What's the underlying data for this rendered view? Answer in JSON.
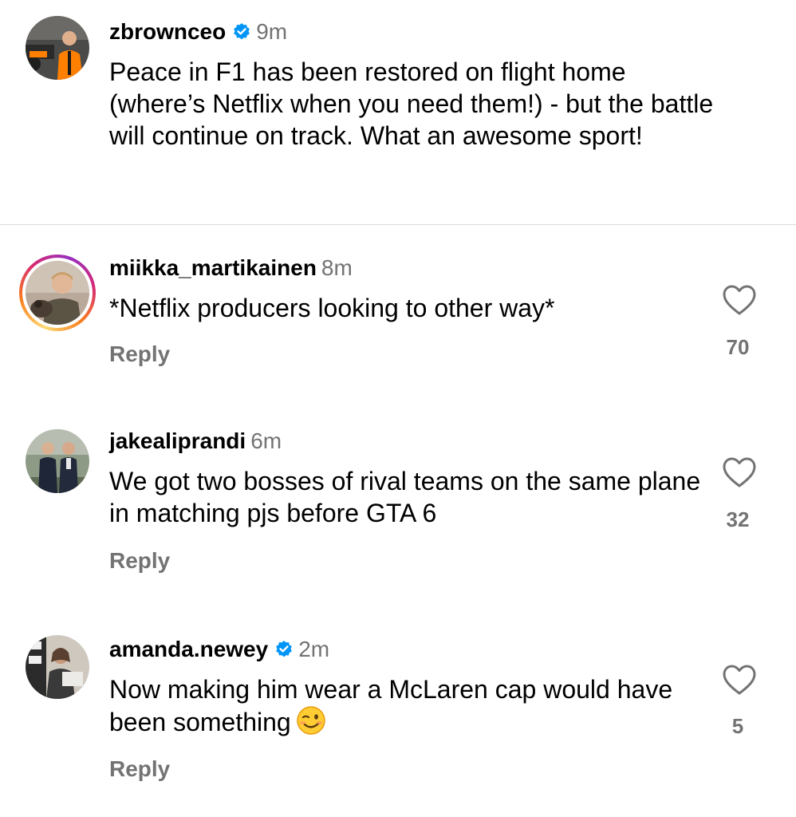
{
  "caption": {
    "username": "zbrownceo",
    "time": "9m",
    "text": "Peace in F1 has been restored on flight home (where’s Netflix when you need them!) - but the battle will continue on track. What an awesome sport!"
  },
  "comments": [
    {
      "username": "miikka_martikainen",
      "time": "8m",
      "text": "*Netflix producers looking to other way*",
      "reply_label": "Reply",
      "likes": "70"
    },
    {
      "username": "jakealiprandi",
      "time": "6m",
      "text": "We got two bosses of rival teams on the same plane in matching pjs before GTA 6",
      "reply_label": "Reply",
      "likes": "32"
    },
    {
      "username": "amanda.newey",
      "time": "2m",
      "text": "Now making him wear a McLaren cap would have been something",
      "emoji": "😉",
      "reply_label": "Reply",
      "likes": "5"
    }
  ],
  "icons": {
    "verified": "verified-badge-icon",
    "like": "heart-outline-icon",
    "emoji": "winking-face-emoji"
  },
  "colors": {
    "verified": "#0095f6",
    "secondary_text": "#737373",
    "divider": "#dbdbdb"
  }
}
